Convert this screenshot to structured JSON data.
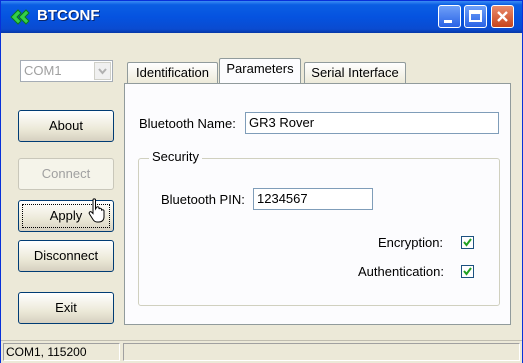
{
  "window": {
    "title": "BTCONF",
    "app_icon": "bluetooth-logo-icon"
  },
  "colors": {
    "titlebar": "#0553e0",
    "close": "#c8441c",
    "panel_border": "#919b9c"
  },
  "port_combo": {
    "value": "COM1",
    "enabled": false
  },
  "buttons": {
    "about": "About",
    "connect": "Connect",
    "apply": "Apply",
    "disconnect": "Disconnect",
    "exit": "Exit"
  },
  "tabs": [
    {
      "label": "Identification",
      "active": false
    },
    {
      "label": "Parameters",
      "active": true
    },
    {
      "label": "Serial Interface",
      "active": false
    }
  ],
  "parameters": {
    "bluetooth_name_label": "Bluetooth Name:",
    "bluetooth_name_value": "GR3 Rover",
    "security": {
      "title": "Security",
      "pin_label": "Bluetooth PIN:",
      "pin_value": "1234567",
      "encryption_label": "Encryption:",
      "encryption_checked": true,
      "authentication_label": "Authentication:",
      "authentication_checked": true
    }
  },
  "statusbar": {
    "port_info": "COM1, 115200"
  }
}
